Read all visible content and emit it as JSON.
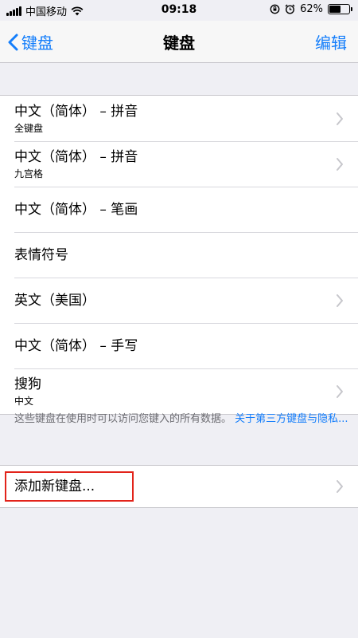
{
  "status_bar": {
    "carrier": "中国移动",
    "time": "09:18",
    "battery_percent": "62%",
    "battery_level": 0.62,
    "icons": [
      "signal-icon",
      "wifi-icon",
      "rotation-lock-icon",
      "alarm-icon",
      "battery-icon"
    ]
  },
  "nav": {
    "back_label": "键盘",
    "title": "键盘",
    "edit_label": "编辑"
  },
  "keyboards": [
    {
      "title": "中文（简体） – 拼音",
      "subtitle": "全键盘",
      "chevron": true
    },
    {
      "title": "中文（简体） – 拼音",
      "subtitle": "九宫格",
      "chevron": true
    },
    {
      "title": "中文（简体） – 笔画",
      "subtitle": "",
      "chevron": false
    },
    {
      "title": "表情符号",
      "subtitle": "",
      "chevron": false
    },
    {
      "title": "英文（美国）",
      "subtitle": "",
      "chevron": true
    },
    {
      "title": "中文（简体） – 手写",
      "subtitle": "",
      "chevron": false
    },
    {
      "title": "搜狗",
      "subtitle": "中文",
      "chevron": true
    }
  ],
  "footer": {
    "text": "这些键盘在使用时可以访问您键入的所有数据。",
    "link": "关于第三方键盘与隐私..."
  },
  "add_keyboard": {
    "label": "添加新键盘..."
  },
  "colors": {
    "accent": "#147efb",
    "background": "#efeff4",
    "highlight": "#e2231a"
  }
}
